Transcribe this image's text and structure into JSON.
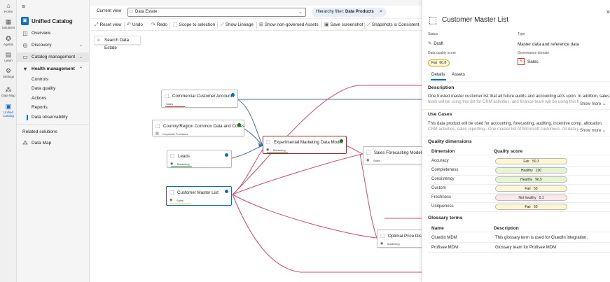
{
  "rail": [
    {
      "label": "Home",
      "icon": "home-icon",
      "glyph": "⌂"
    },
    {
      "label": "Solutions",
      "icon": "grid-icon",
      "glyph": "▦"
    },
    {
      "label": "Agents",
      "icon": "agents-icon",
      "glyph": "✪"
    },
    {
      "label": "Learn",
      "icon": "book-icon",
      "glyph": "▤"
    },
    {
      "label": "Settings",
      "icon": "gear-icon",
      "glyph": "⚙"
    },
    {
      "label": "Data Map",
      "icon": "data-map-icon",
      "glyph": "⁂"
    },
    {
      "label": "Unified Catalog",
      "icon": "catalog-icon",
      "glyph": "▣"
    }
  ],
  "nav": {
    "app_title": "Unified Catalog",
    "overview": "Overview",
    "discovery": "Discovery",
    "catalog_management": "Catalog management",
    "health_management": "Health management",
    "controls": "Controls",
    "data_quality": "Data quality",
    "actions": "Actions",
    "reports": "Reports",
    "data_observability": "Data observability",
    "related_solutions": "Related solutions",
    "data_map": "Data Map"
  },
  "toolbar": {
    "current_view_label": "Current view",
    "current_view_value": "Data Estate",
    "hierarchy_filter": "Hierarchy filter: ",
    "hierarchy_filter_value": "Data Products",
    "reset_view": "Reset view",
    "undo": "Undo",
    "redo": "Redo",
    "scope_to_selection": "Scope to selection",
    "show_lineage": "Show Lineage",
    "show_non_governed": "Show non-governed Assets",
    "save_screenshot": "Save screenshot",
    "snapshots": "Snapshots is Consistent"
  },
  "search": {
    "label": "Search Data Estate"
  },
  "nodes": {
    "commercial": {
      "title": "Commercial Customer Accounts",
      "tag": "Sales",
      "dot": "#0f6cbd",
      "bar": "#d13438"
    },
    "country": {
      "title": "Country/Region Common Data and Codes",
      "tag": "Corporate Functions",
      "dot": "#107c10",
      "bar": ""
    },
    "leads": {
      "title": "Leads",
      "tag": "Marketing",
      "dot": "#0f6cbd",
      "bar": "#107c10"
    },
    "customer": {
      "title": "Customer Master List",
      "tag": "Sales",
      "dot": "#0f6cbd",
      "bar": "#f7a700"
    },
    "experimental": {
      "title": "Experimental Marketing Data Model",
      "tag": "Marketing",
      "dot": "#107c10",
      "bar": "#107c10"
    },
    "forecast": {
      "title": "Sales Forecasting Model w",
      "tag": "Sales",
      "dot": "",
      "bar": ""
    },
    "optimal": {
      "title": "Optimal Price Disco",
      "tag": "Marketing",
      "dot": "",
      "bar": ""
    }
  },
  "panel": {
    "title": "Customer Master List",
    "status_label": "Status",
    "status_value": "Draft",
    "type_label": "Type",
    "type_value": "Master data and reference data",
    "dq_label": "Data quality score",
    "dq_value": "Fair",
    "dq_score": "60.8",
    "gov_label": "Governance domain",
    "gov_badge": "S",
    "gov_value": "Sales",
    "tab_details": "Details",
    "tab_assets": "Assets",
    "description_title": "Description",
    "description_line1": "One trusted master customer list that all future audits and accounting acts upon. In addition, sales",
    "description_line2": "team will be using this list for CRM activities, and finance team will be using this list for ...",
    "show_more_1": "Show more",
    "use_cases_title": "Use Cases",
    "use_cases_line1": "This data product will be used for accounting, forecasting, auditing, incentive comp. allocation,",
    "use_cases_line2": "CRM activities, sales reporting.. One master list of Microsoft customers. All data products ...",
    "show_more_2": "Show more",
    "quality_title": "Quality dimensions",
    "dim_header": "Dimension",
    "score_header": "Quality score",
    "dimensions": [
      {
        "name": "Accuracy",
        "label": "Fair",
        "score": "50.3",
        "color": "#fdf6d3"
      },
      {
        "name": "Completeness",
        "label": "Healthy",
        "score": "100",
        "color": "#e5f5d4"
      },
      {
        "name": "Consistency",
        "label": "Healthy",
        "score": "96.5",
        "color": "#e5f5d4"
      },
      {
        "name": "Custom",
        "label": "Fair",
        "score": "50",
        "color": "#fdf6d3"
      },
      {
        "name": "Freshness",
        "label": "Not healthy",
        "score": "0.1",
        "color": "#fde7e9"
      },
      {
        "name": "Uniqueness",
        "label": "Fair",
        "score": "50",
        "color": "#fdf6d3"
      }
    ],
    "glossary_title": "Glossary terms",
    "name_header": "Name",
    "desc_header": "Description",
    "glossary": [
      {
        "name": "CluedIn MDM",
        "desc": "This glossary term is used for CluedIn integration."
      },
      {
        "name": "Profisee MDM",
        "desc": "Glossary team for Profisee MDM"
      }
    ]
  }
}
